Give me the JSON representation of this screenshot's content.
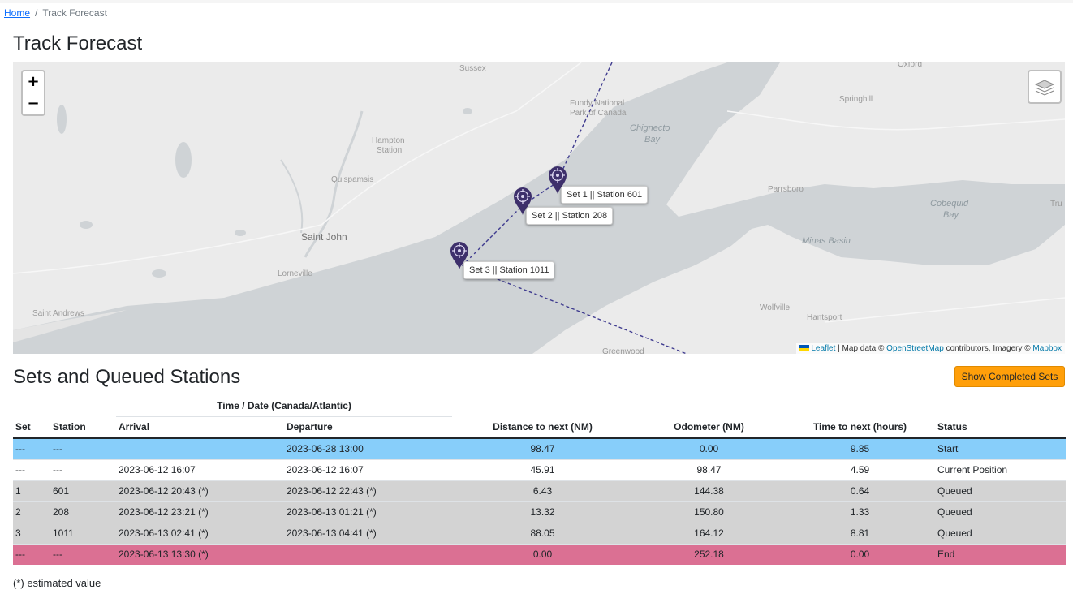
{
  "breadcrumb": {
    "home": "Home",
    "separator": "/",
    "current": "Track Forecast"
  },
  "page_title": "Track Forecast",
  "map": {
    "zoom_in": "+",
    "zoom_out": "−",
    "labels": {
      "sussex": "Sussex",
      "oxford": "Oxford",
      "fundy": "Fundy National",
      "fundy2": "Park of Canada",
      "chignecto": "Chignecto",
      "chignecto2": "Bay",
      "springhill": "Springhill",
      "hampton": "Hampton",
      "hampton2": "Station",
      "quispamsis": "Quispamsis",
      "parrsboro": "Parrsboro",
      "cobequid": "Cobequid",
      "cobequid2": "Bay",
      "tru": "Tru",
      "saint_john": "Saint John",
      "minas": "Minas Basin",
      "lorneville": "Lorneville",
      "saint_andrews": "Saint Andrews",
      "wolfville": "Wolfville",
      "hantsport": "Hantsport",
      "greenwood": "Greenwood"
    },
    "tooltips": {
      "set1": "Set 1 || Station 601",
      "set2": "Set 2 || Station 208",
      "set3": "Set 3 || Station 1011"
    },
    "attribution": {
      "leaflet": "Leaflet",
      "map_data": "| Map data ©",
      "osm": "OpenStreetMap",
      "imagery": "contributors, Imagery ©",
      "mapbox": "Mapbox"
    },
    "colors": {
      "track": "#3f3b8f",
      "marker": "#3d2f6b",
      "water": "#cfd3d6",
      "land": "#ebebeb"
    }
  },
  "section_title": "Sets and Queued Stations",
  "show_completed_button": "Show Completed Sets",
  "table": {
    "group_header": "Time / Date (Canada/Atlantic)",
    "headers": {
      "set": "Set",
      "station": "Station",
      "arrival": "Arrival",
      "departure": "Departure",
      "distance": "Distance to next (NM)",
      "odometer": "Odometer (NM)",
      "time_next": "Time to next (hours)",
      "status": "Status"
    },
    "rows": [
      {
        "set": "---",
        "station": "---",
        "arrival": "",
        "departure": "2023-06-28 13:00",
        "distance": "98.47",
        "odometer": "0.00",
        "time_next": "9.85",
        "status": "Start"
      },
      {
        "set": "---",
        "station": "---",
        "arrival": "2023-06-12 16:07",
        "departure": "2023-06-12 16:07",
        "distance": "45.91",
        "odometer": "98.47",
        "time_next": "4.59",
        "status": "Current Position"
      },
      {
        "set": "1",
        "station": "601",
        "arrival": "2023-06-12 20:43 (*)",
        "departure": "2023-06-12 22:43 (*)",
        "distance": "6.43",
        "odometer": "144.38",
        "time_next": "0.64",
        "status": "Queued"
      },
      {
        "set": "2",
        "station": "208",
        "arrival": "2023-06-12 23:21 (*)",
        "departure": "2023-06-13 01:21 (*)",
        "distance": "13.32",
        "odometer": "150.80",
        "time_next": "1.33",
        "status": "Queued"
      },
      {
        "set": "3",
        "station": "1011",
        "arrival": "2023-06-13 02:41 (*)",
        "departure": "2023-06-13 04:41 (*)",
        "distance": "88.05",
        "odometer": "164.12",
        "time_next": "8.81",
        "status": "Queued"
      },
      {
        "set": "---",
        "station": "---",
        "arrival": "2023-06-13 13:30 (*)",
        "departure": "",
        "distance": "0.00",
        "odometer": "252.18",
        "time_next": "0.00",
        "status": "End"
      }
    ],
    "row_colors": {
      "start": "#87cefa",
      "current": "#ffffff",
      "queued": "#d3d3d3",
      "end": "#db7093"
    }
  },
  "footnote": "(*) estimated value"
}
